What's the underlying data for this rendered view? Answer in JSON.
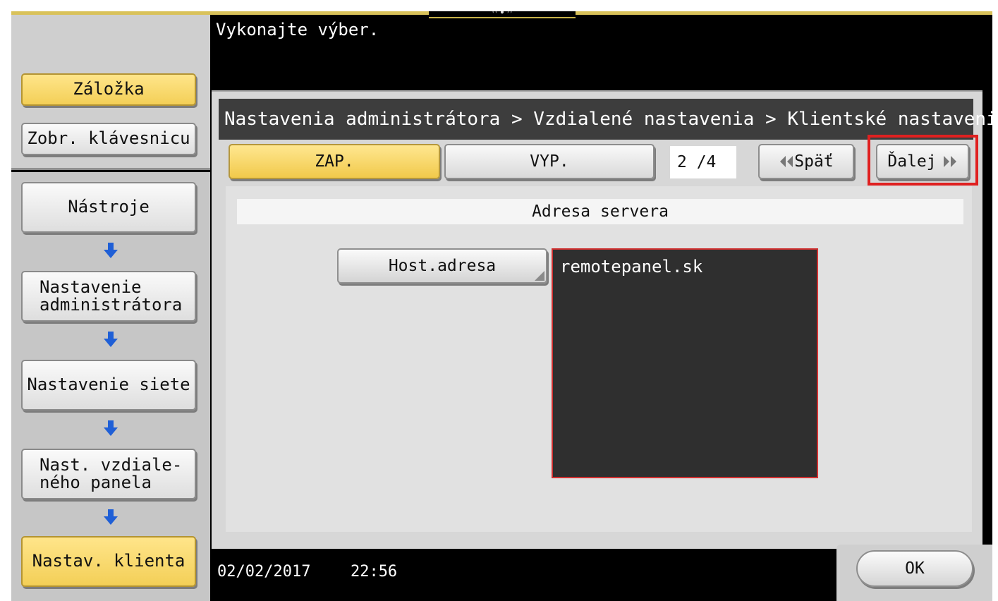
{
  "message": "Vykonajte výber.",
  "sidebar": {
    "bookmark": "Záložka",
    "show_keyboard": "Zobr. klávesnicu",
    "path": [
      {
        "label": "Nástroje"
      },
      {
        "label": "Nastavenie\nadministrátora"
      },
      {
        "label": "Nastavenie siete"
      },
      {
        "label": "Nast. vzdiale-\nného panela"
      },
      {
        "label": "Nastav. klienta"
      }
    ]
  },
  "breadcrumb": "Nastavenia administrátora > Vzdialené nastavenia > Klientské nastavenia",
  "toggle": {
    "on": "ZAP.",
    "off": "VYP."
  },
  "page_indicator": "2 /4",
  "nav": {
    "back": "Späť",
    "next": "Ďalej"
  },
  "section_title": "Adresa servera",
  "host": {
    "label": "Host.adresa",
    "value": "remotepanel.sk"
  },
  "footer": {
    "date": "02/02/2017",
    "time": "22:56",
    "ok": "OK"
  },
  "colors": {
    "highlight_red": "#e02020",
    "selected_yellow": "#f3cf57",
    "arrow_blue": "#1f5fd6"
  },
  "icons": {
    "nav_back": "double-chevron-left-icon",
    "nav_next": "double-chevron-right-icon",
    "path_arrow": "arrow-down-icon"
  }
}
